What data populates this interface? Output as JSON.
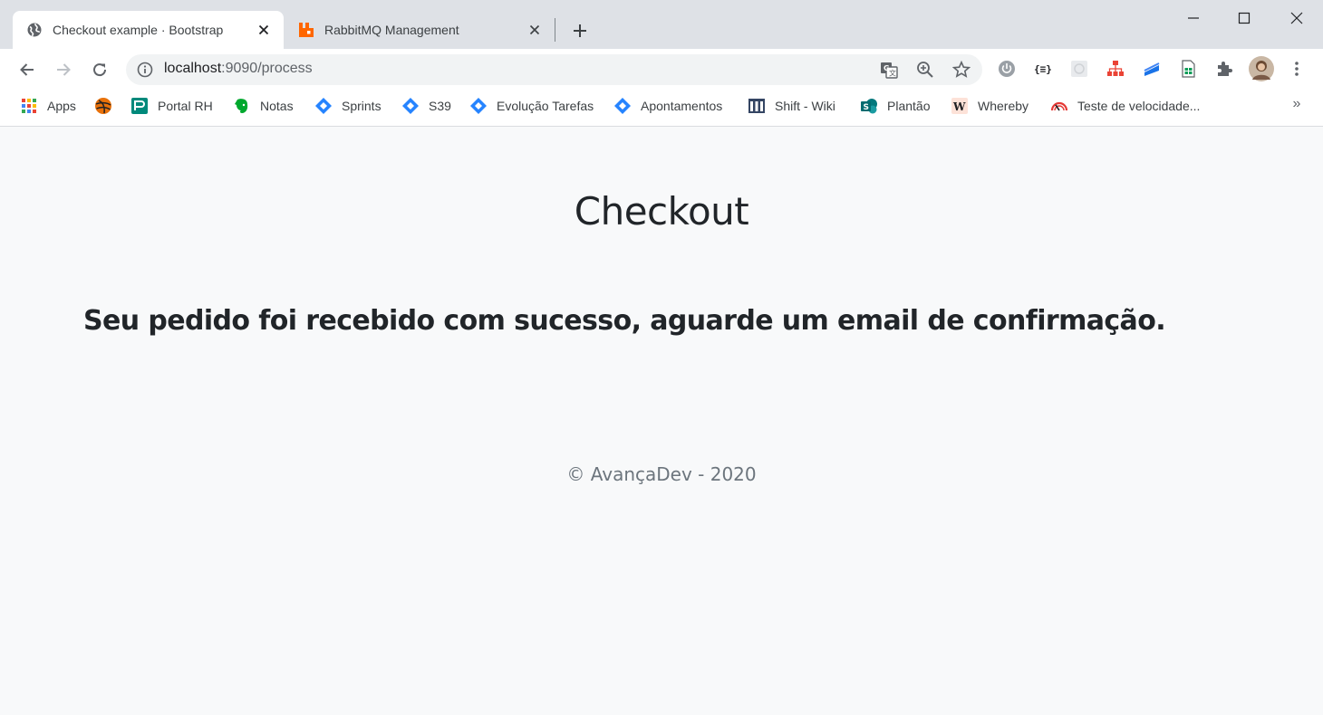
{
  "browser": {
    "tabs": [
      {
        "label": "Checkout example · Bootstrap",
        "active": true,
        "icon": "globe-icon"
      },
      {
        "label": "RabbitMQ Management",
        "active": false,
        "icon": "rabbitmq-icon"
      }
    ],
    "address": {
      "host": "localhost",
      "rest": ":9090/process"
    },
    "bookmarks": [
      {
        "label": "Apps",
        "icon": "apps-grid-icon"
      },
      {
        "label": "",
        "icon": "orange-ball-icon"
      },
      {
        "label": "Portal RH",
        "icon": "portal-icon"
      },
      {
        "label": "Notas",
        "icon": "evernote-icon"
      },
      {
        "label": "Sprints",
        "icon": "jira-icon"
      },
      {
        "label": "S39",
        "icon": "jira-icon"
      },
      {
        "label": "Evolução Tarefas",
        "icon": "jira-icon"
      },
      {
        "label": "Apontamentos",
        "icon": "jira-icon"
      },
      {
        "label": "Shift - Wiki",
        "icon": "wiki-icon"
      },
      {
        "label": "Plantão",
        "icon": "sharepoint-icon"
      },
      {
        "label": "Whereby",
        "icon": "whereby-icon"
      },
      {
        "label": "Teste de velocidade...",
        "icon": "speedometer-icon"
      }
    ],
    "bookmarks_overflow": "»",
    "colors": {
      "tabstrip": "#dee1e6",
      "jira": "#2684ff",
      "rabbitmq": "#ff6600"
    }
  },
  "page": {
    "title": "Checkout",
    "message": "Seu pedido foi recebido com sucesso, aguarde um email de confirmação.",
    "footer": "© AvançaDev - 2020"
  }
}
